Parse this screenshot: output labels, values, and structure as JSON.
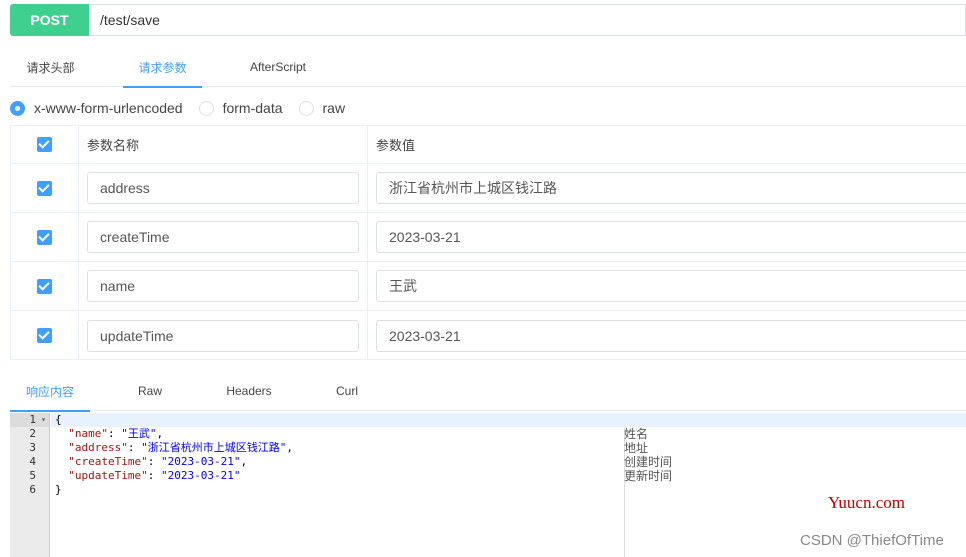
{
  "request": {
    "method": "POST",
    "url": "/test/save",
    "method_color": "#3fcf8e"
  },
  "request_tabs": [
    {
      "label": "请求头部",
      "active": false
    },
    {
      "label": "请求参数",
      "active": true
    },
    {
      "label": "AfterScript",
      "active": false
    }
  ],
  "body_types": [
    {
      "label": "x-www-form-urlencoded",
      "selected": true
    },
    {
      "label": "form-data",
      "selected": false
    },
    {
      "label": "raw",
      "selected": false
    }
  ],
  "params_table": {
    "headers": {
      "name": "参数名称",
      "value": "参数值"
    },
    "rows": [
      {
        "checked": true,
        "name": "address",
        "value": "浙江省杭州市上城区钱江路"
      },
      {
        "checked": true,
        "name": "createTime",
        "value": "2023-03-21"
      },
      {
        "checked": true,
        "name": "name",
        "value": "王武"
      },
      {
        "checked": true,
        "name": "updateTime",
        "value": "2023-03-21"
      }
    ]
  },
  "response_tabs": [
    {
      "label": "响应内容",
      "active": true
    },
    {
      "label": "Raw",
      "active": false
    },
    {
      "label": "Headers",
      "active": false
    },
    {
      "label": "Curl",
      "active": false
    }
  ],
  "response_body": {
    "line_numbers": [
      "1",
      "2",
      "3",
      "4",
      "5",
      "6"
    ],
    "open_brace": "{",
    "close_brace": "}",
    "fields": [
      {
        "key": "\"name\"",
        "value": "\"王武\"",
        "comment": "姓名",
        "trailing": ","
      },
      {
        "key": "\"address\"",
        "value": "\"浙江省杭州市上城区钱江路\"",
        "comment": "地址",
        "trailing": ","
      },
      {
        "key": "\"createTime\"",
        "value": "\"2023-03-21\"",
        "comment": "创建时间",
        "trailing": ","
      },
      {
        "key": "\"updateTime\"",
        "value": "\"2023-03-21\"",
        "comment": "更新时间",
        "trailing": ""
      }
    ]
  },
  "watermarks": {
    "site": "Yuucn.com",
    "author": "CSDN @ThiefOfTime"
  },
  "colors": {
    "accent": "#409eff",
    "json_key": "#a31515",
    "json_string": "#0000ff"
  }
}
